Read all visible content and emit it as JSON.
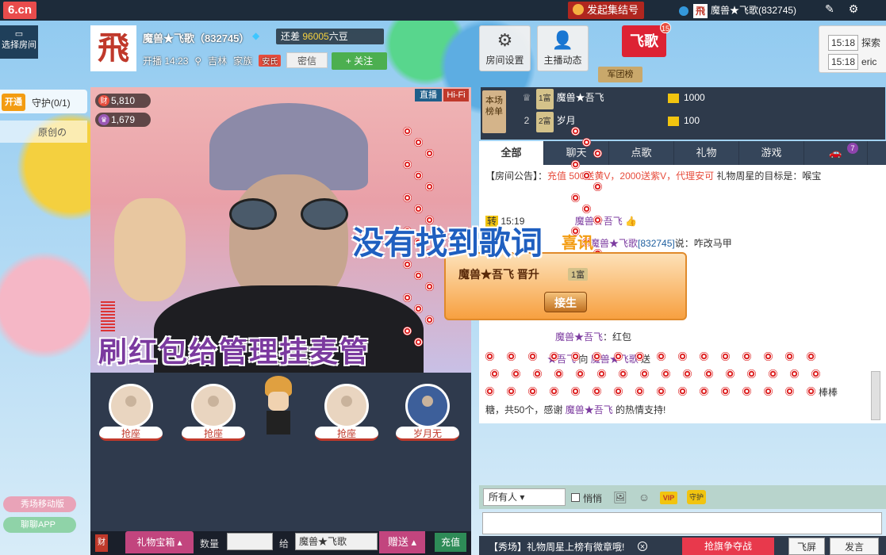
{
  "topbar": {
    "logo": "6.cn",
    "start_button": "发起集结号",
    "username": "魔兽★飞歌(832745)"
  },
  "left": {
    "select_room": "选择房间",
    "open_label": "开通",
    "guard_label": "守护(0/1)",
    "guard_name": "原创の",
    "mobile_show": "秀场移动版",
    "chat_app": "聊聊APP"
  },
  "streamer": {
    "avatar_char": "飛",
    "name": "魔兽★飞歌（832745）",
    "level_gap": "还差 ",
    "level_gap_value": "96005",
    "level_gap_unit": "六豆",
    "start_time": "开播 14:23",
    "location": "吉林",
    "family_label": "家族",
    "family_tag": "安氏",
    "private_msg": "密信",
    "follow": "+ 关注"
  },
  "room": {
    "settings": "房间设置",
    "host_news": "主播动态",
    "flag_name": "飞歌",
    "flag_badge": "15",
    "army": "军团榜"
  },
  "notifications": [
    {
      "time": "15:18",
      "text": "探索"
    },
    {
      "time": "15:18",
      "text": "eric"
    }
  ],
  "video": {
    "live_label": "直播",
    "hifi_label": "Hi-Fi",
    "wealth": "5,810",
    "wealth_icon": "财",
    "fans": "1,679",
    "banner": "刷红包给管理挂麦管",
    "lyric": "没有找到歌词"
  },
  "seats": {
    "seat_label": "抢座",
    "seat4_name": "岁月无"
  },
  "gift_bar": {
    "wealth_tag": "财",
    "gift_box": "礼物宝箱",
    "quantity_label": "数量",
    "to_label": "给",
    "recipient": "魔兽★飞歌",
    "send": "赠送",
    "recharge": "充值"
  },
  "ranking": {
    "label": "本场榜单",
    "rows": [
      {
        "rank": "",
        "level": "1富",
        "name": "魔兽★吾飞",
        "score": "1000"
      },
      {
        "rank": "2",
        "level": "2富",
        "name": "岁月",
        "score": "100"
      }
    ]
  },
  "tabs": [
    "全部",
    "聊天",
    "点歌",
    "礼物",
    "游戏"
  ],
  "car_badge": "7",
  "chat": {
    "notice_prefix": "【房间公告】：",
    "notice_red": "充值",
    "notice_mid": " 500送黄V，2000送紫V，代理安可",
    "notice_tail": " 礼物周星的目标是：喉宝",
    "line1_time": "15:19",
    "line1_tag": "转",
    "line1_user": "魔兽★吾飞",
    "line2_user": "魔兽★飞歌",
    "line2_id": "[832745]",
    "line2_text": "说：咋改马甲",
    "line3_user": "魔兽★吾飞",
    "line3_text": "：红包",
    "line4_from": "★吾飞",
    "line4_mid": " 向 ",
    "line4_to": "魔兽★飞歌",
    "line4_send": " 送",
    "line4_gift": "棒棒",
    "line5_a": "糖，共50个，感谢 ",
    "line5_user": "魔兽★吾飞",
    "line5_b": " 的热情支持!"
  },
  "level_up": {
    "name": "魔兽★吾飞",
    "action": "晋升",
    "level": "1富",
    "button": "接生",
    "tag": "喜讯"
  },
  "input": {
    "to_all": "所有人",
    "whisper": "悄悄",
    "vip": "VIP",
    "guard": "守护"
  },
  "footer": {
    "ticker": "【秀场】礼物周星上榜有微章哦!",
    "grab": "抢旗争夺战",
    "fly": "飞屏",
    "speak": "发言"
  }
}
